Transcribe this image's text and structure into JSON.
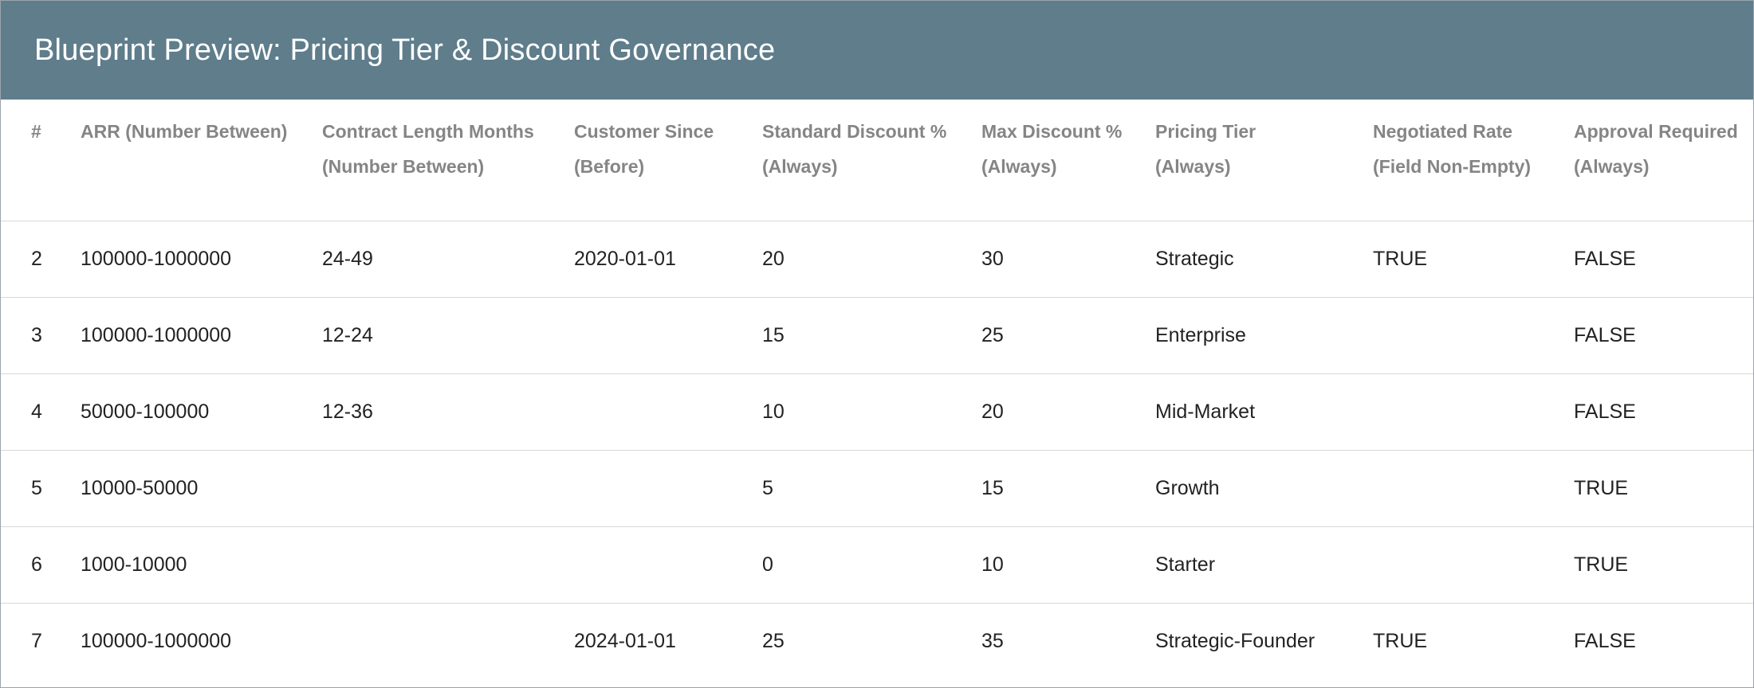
{
  "title": "Blueprint Preview: Pricing Tier & Discount Governance",
  "columns": [
    {
      "line1": "#",
      "line2": ""
    },
    {
      "line1": "ARR (Number Between)",
      "line2": ""
    },
    {
      "line1": "Contract Length Months",
      "line2": "(Number Between)"
    },
    {
      "line1": "Customer Since",
      "line2": "(Before)"
    },
    {
      "line1": "Standard Discount %",
      "line2": "(Always)"
    },
    {
      "line1": "Max Discount %",
      "line2": "(Always)"
    },
    {
      "line1": "Pricing Tier",
      "line2": "(Always)"
    },
    {
      "line1": "Negotiated Rate",
      "line2": "(Field Non-Empty)"
    },
    {
      "line1": "Approval Required",
      "line2": "(Always)"
    }
  ],
  "rows": [
    [
      "2",
      "100000-1000000",
      "24-49",
      "2020-01-01",
      "20",
      "30",
      "Strategic",
      "TRUE",
      "FALSE"
    ],
    [
      "3",
      "100000-1000000",
      "12-24",
      "",
      "15",
      "25",
      "Enterprise",
      "",
      "FALSE"
    ],
    [
      "4",
      "50000-100000",
      "12-36",
      "",
      "10",
      "20",
      "Mid-Market",
      "",
      "FALSE"
    ],
    [
      "5",
      "10000-50000",
      "",
      "",
      "5",
      "15",
      "Growth",
      "",
      "TRUE"
    ],
    [
      "6",
      "1000-10000",
      "",
      "",
      "0",
      "10",
      "Starter",
      "",
      "TRUE"
    ],
    [
      "7",
      "100000-1000000",
      "",
      "2024-01-01",
      "25",
      "35",
      "Strategic-Founder",
      "TRUE",
      "FALSE"
    ]
  ]
}
